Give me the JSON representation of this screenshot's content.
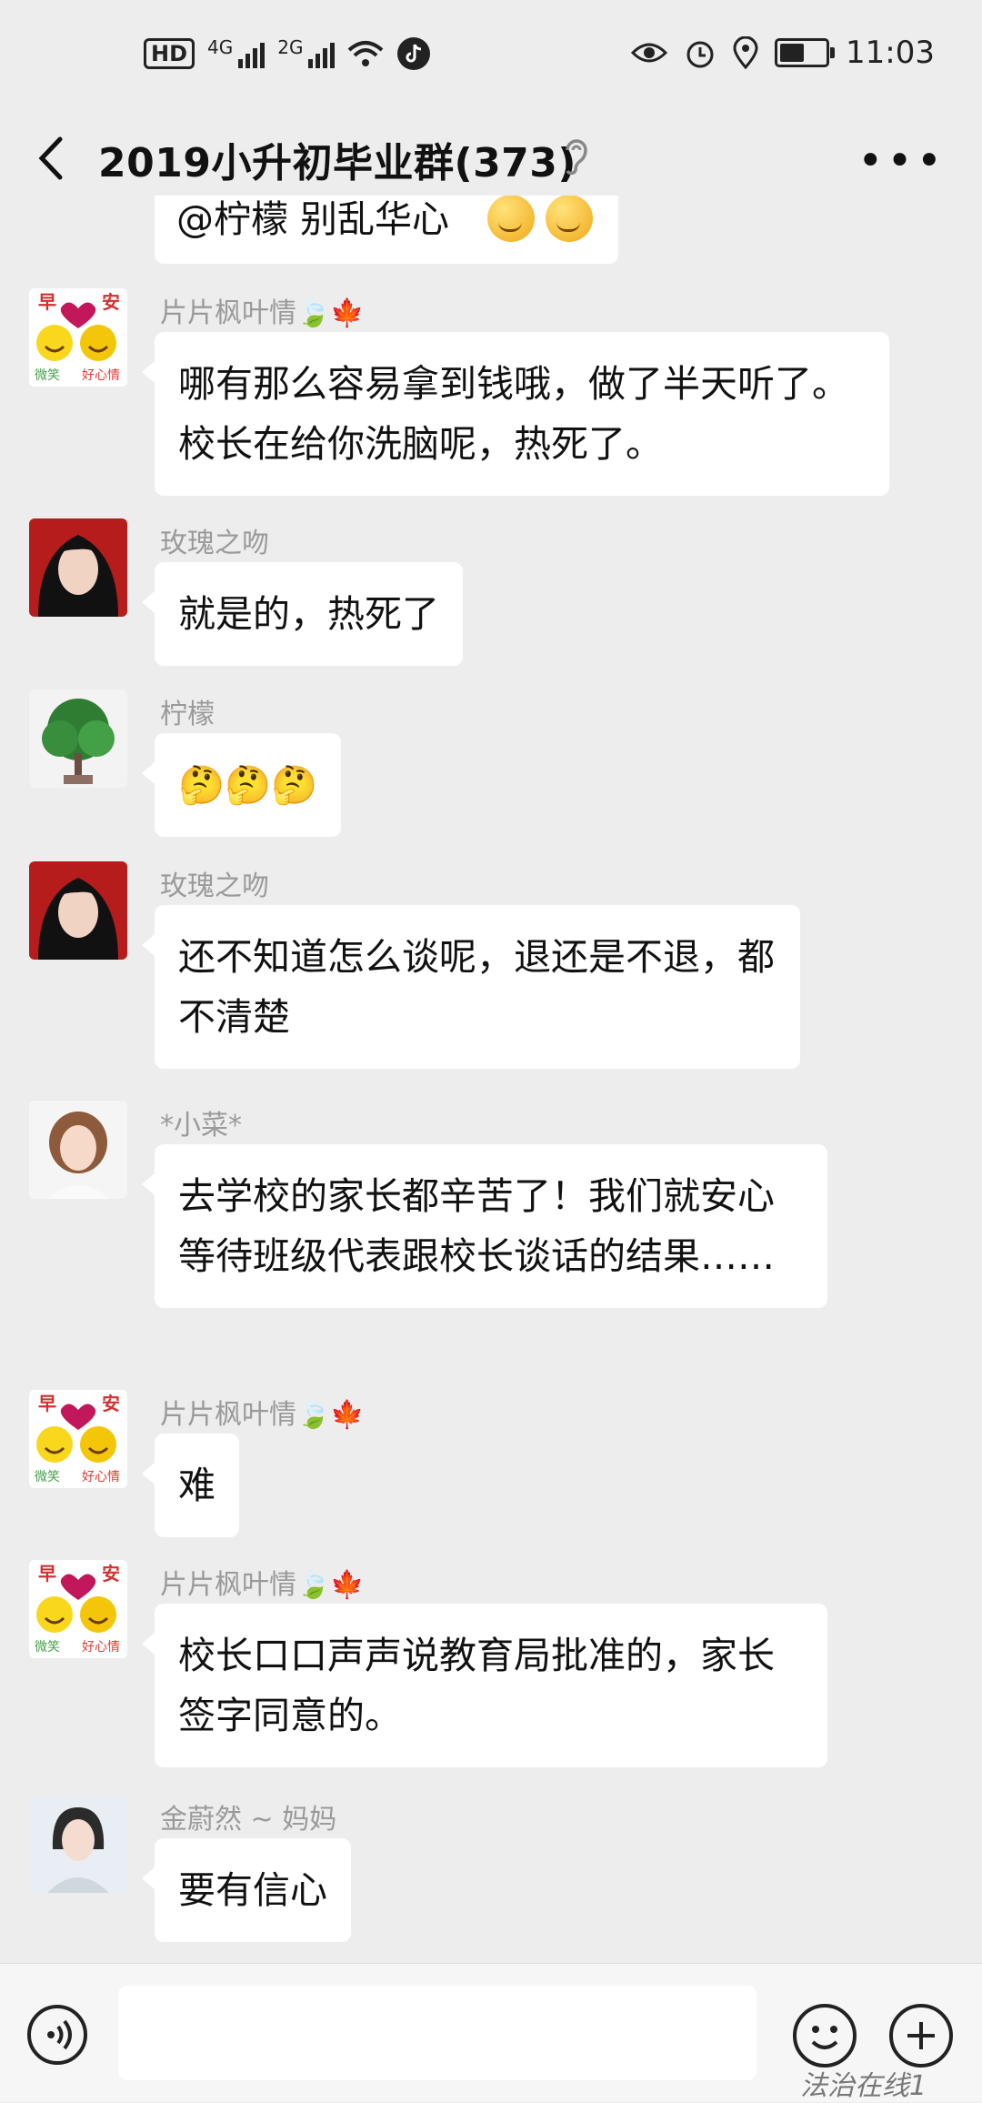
{
  "status_bar": {
    "hd_badge": "HD",
    "network_1": "4G",
    "network_2": "2G",
    "time": "11:03",
    "icons": [
      "wifi-icon",
      "tiktok-icon",
      "eye-icon",
      "alarm-icon",
      "location-icon",
      "battery-icon"
    ],
    "battery_level": 0.55
  },
  "header": {
    "title": "2019小升初毕业群(373)",
    "icons": [
      "back-icon",
      "earpiece-icon",
      "more-icon"
    ]
  },
  "messages": [
    {
      "name": "",
      "text": "@柠檬 别乱华心"
    },
    {
      "name": "片片枫叶情🍃🍁",
      "text": "哪有那么容易拿到钱哦，做了半天听了。校长在给你洗脑呢，热死了。"
    },
    {
      "name": "玫瑰之吻",
      "text": "就是的，热死了"
    },
    {
      "name": "柠檬",
      "text": "🤔🤔🤔"
    },
    {
      "name": "玫瑰之吻",
      "text": "还不知道怎么谈呢，退还是不退，都不清楚"
    },
    {
      "name": "*小菜*",
      "text": "去学校的家长都辛苦了！我们就安心等待班级代表跟校长谈话的结果……"
    },
    {
      "name": "片片枫叶情🍃🍁",
      "text": "难"
    },
    {
      "name": "片片枫叶情🍃🍁",
      "text": "校长口口声声说教育局批准的，家长签字同意的。"
    },
    {
      "name": "金蔚然 ~ 妈妈",
      "text": "要有信心"
    }
  ],
  "avatar_text": {
    "top_left": "早",
    "top_right": "安",
    "bottom_left": "微笑",
    "bottom_right": "好心情"
  },
  "input_bar": {
    "placeholder": "",
    "icons": [
      "voice-icon",
      "emoji-icon",
      "plus-icon"
    ]
  },
  "watermark": "法治在线1"
}
